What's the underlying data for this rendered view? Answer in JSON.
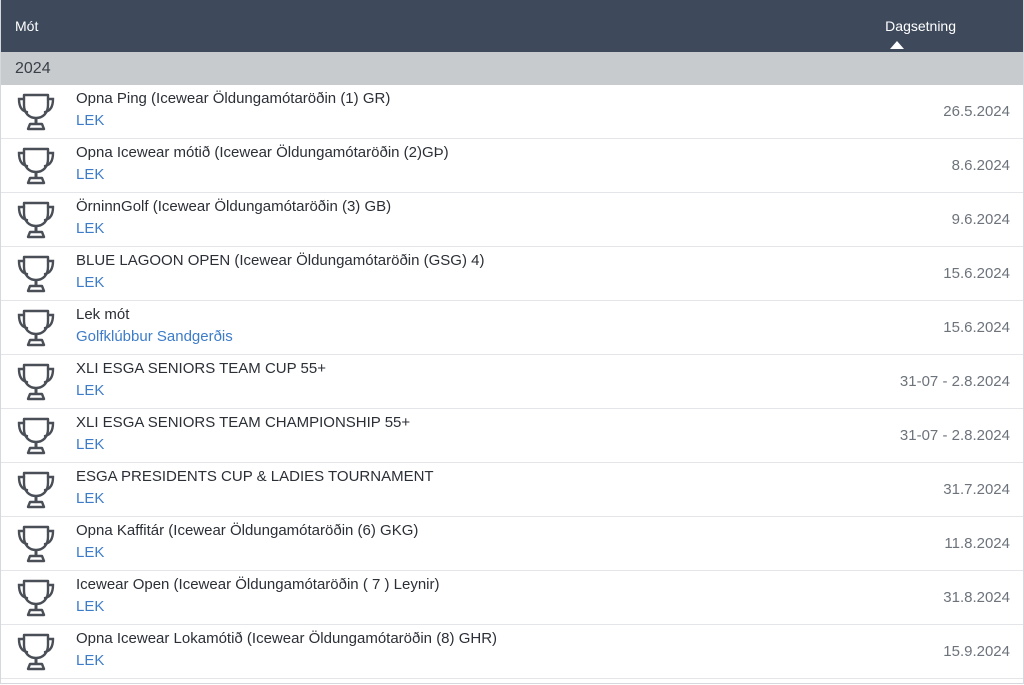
{
  "header": {
    "tournament_label": "Mót",
    "date_label": "Dagsetning"
  },
  "group": {
    "year": "2024"
  },
  "tournaments": [
    {
      "name": "Opna Ping (Icewear Öldungamótaröðin (1) GR)",
      "club": "LEK",
      "date": "26.5.2024"
    },
    {
      "name": "Opna Icewear mótið (Icewear Öldungamótaröðin (2)GÞ)",
      "club": "LEK",
      "date": "8.6.2024"
    },
    {
      "name": "ÖrninnGolf (Icewear Öldungamótaröðin (3) GB)",
      "club": "LEK",
      "date": "9.6.2024"
    },
    {
      "name": "BLUE LAGOON OPEN (Icewear Öldungamótaröðin (GSG) 4)",
      "club": "LEK",
      "date": "15.6.2024"
    },
    {
      "name": "Lek mót",
      "club": "Golfklúbbur Sandgerðis",
      "date": "15.6.2024"
    },
    {
      "name": "XLI ESGA SENIORS TEAM CUP 55+",
      "club": "LEK",
      "date": "31-07 - 2.8.2024"
    },
    {
      "name": "XLI ESGA SENIORS TEAM CHAMPIONSHIP 55+",
      "club": "LEK",
      "date": "31-07 - 2.8.2024"
    },
    {
      "name": "ESGA PRESIDENTS CUP & LADIES TOURNAMENT",
      "club": "LEK",
      "date": "31.7.2024"
    },
    {
      "name": "Opna Kaffitár (Icewear Öldungamótaröðin (6) GKG)",
      "club": "LEK",
      "date": "11.8.2024"
    },
    {
      "name": "Icewear Open (Icewear Öldungamótaröðin ( 7 ) Leynir)",
      "club": "LEK",
      "date": "31.8.2024"
    },
    {
      "name": "Opna Icewear Lokamótið (Icewear Öldungamótaröðin (8) GHR)",
      "club": "LEK",
      "date": "15.9.2024"
    }
  ],
  "icons": {
    "row_icon": "trophy-icon",
    "sort_icon": "sort-ascending-icon"
  },
  "colors": {
    "header_bg": "#3e4a5c",
    "group_bg": "#c8cbce",
    "link": "#3d7cc9"
  }
}
